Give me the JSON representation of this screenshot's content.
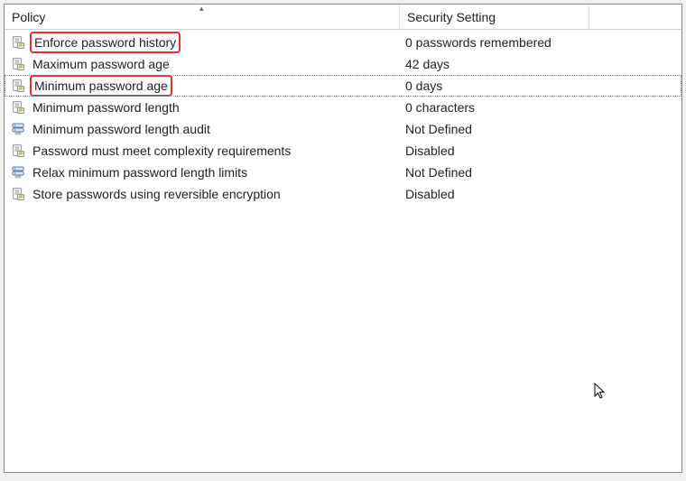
{
  "columns": {
    "policy": "Policy",
    "setting": "Security Setting"
  },
  "rows": [
    {
      "icon": "policy-icon",
      "label": "Enforce password history",
      "value": "0 passwords remembered",
      "highlight": true,
      "selected": false
    },
    {
      "icon": "policy-icon",
      "label": "Maximum password age",
      "value": "42 days",
      "highlight": false,
      "selected": false
    },
    {
      "icon": "policy-icon",
      "label": "Minimum password age",
      "value": "0 days",
      "highlight": true,
      "selected": true
    },
    {
      "icon": "policy-icon",
      "label": "Minimum password length",
      "value": "0 characters",
      "highlight": false,
      "selected": false
    },
    {
      "icon": "server-icon",
      "label": "Minimum password length audit",
      "value": "Not Defined",
      "highlight": false,
      "selected": false
    },
    {
      "icon": "policy-icon",
      "label": "Password must meet complexity requirements",
      "value": "Disabled",
      "highlight": false,
      "selected": false
    },
    {
      "icon": "server-icon",
      "label": "Relax minimum password length limits",
      "value": "Not Defined",
      "highlight": false,
      "selected": false
    },
    {
      "icon": "policy-icon",
      "label": "Store passwords using reversible encryption",
      "value": "Disabled",
      "highlight": false,
      "selected": false
    }
  ]
}
